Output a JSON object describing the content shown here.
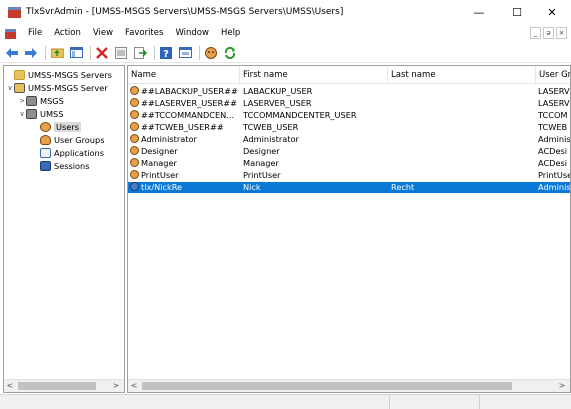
{
  "window": {
    "title": "TlxSvrAdmin - [UMSS-MSGS Servers\\UMSS-MSGS Servers\\UMSS\\Users]",
    "minimize": "—",
    "maximize": "☐",
    "close": "✕"
  },
  "menubar": {
    "items": [
      "File",
      "Action",
      "View",
      "Favorites",
      "Window",
      "Help"
    ],
    "mdi": [
      "_",
      "ə",
      "×"
    ]
  },
  "toolbar": {
    "icons": [
      "back-arrow-icon",
      "forward-arrow-icon",
      "up-folder-icon",
      "show-tree-icon",
      "delete-icon",
      "properties-icon",
      "export-icon",
      "help-icon",
      "console-icon",
      "user-icon",
      "refresh-icon"
    ]
  },
  "tree": {
    "items": [
      {
        "label": "UMSS-MSGS Servers",
        "level": 0,
        "expander": ""
      },
      {
        "label": "UMSS-MSGS Server",
        "level": 0,
        "expander": "∨"
      },
      {
        "label": "MSGS",
        "level": 1,
        "expander": ">"
      },
      {
        "label": "UMSS",
        "level": 1,
        "expander": "∨"
      },
      {
        "label": "Users",
        "level": 2,
        "expander": ""
      },
      {
        "label": "User Groups",
        "level": 2,
        "expander": ""
      },
      {
        "label": "Applications",
        "level": 2,
        "expander": ""
      },
      {
        "label": "Sessions",
        "level": 2,
        "expander": ""
      }
    ],
    "scroll_left": "<",
    "scroll_right": ">"
  },
  "list": {
    "columns": [
      "Name",
      "First name",
      "Last name",
      "User Gro"
    ],
    "rows": [
      {
        "name": "##LABACKUP_USER##",
        "first": "LABACKUP_USER",
        "last": "",
        "group": "LASERV"
      },
      {
        "name": "##LASERVER_USER##",
        "first": "LASERVER_USER",
        "last": "",
        "group": "LASERV"
      },
      {
        "name": "##TCCOMMANDCEN...",
        "first": "TCCOMMANDCENTER_USER",
        "last": "",
        "group": "TCCOM"
      },
      {
        "name": "##TCWEB_USER##",
        "first": "TCWEB_USER",
        "last": "",
        "group": "TCWEB"
      },
      {
        "name": "Administrator",
        "first": "Administrator",
        "last": "",
        "group": "Adminis"
      },
      {
        "name": "Designer",
        "first": "Designer",
        "last": "",
        "group": "ACDesi"
      },
      {
        "name": "Manager",
        "first": "Manager",
        "last": "",
        "group": "ACDesi"
      },
      {
        "name": "PrintUser",
        "first": "PrintUser",
        "last": "",
        "group": "PrintUse"
      },
      {
        "name": "tlx/NickRe",
        "first": "Nick",
        "last": "Recht",
        "group": "Adminis"
      }
    ],
    "selected_row": "tlx/NickRe",
    "scroll_left": "<",
    "scroll_right": ">"
  },
  "colors": {
    "selection": "#0a78d7",
    "border": "#a0a0a0",
    "statusbar": "#f0f0f0"
  }
}
